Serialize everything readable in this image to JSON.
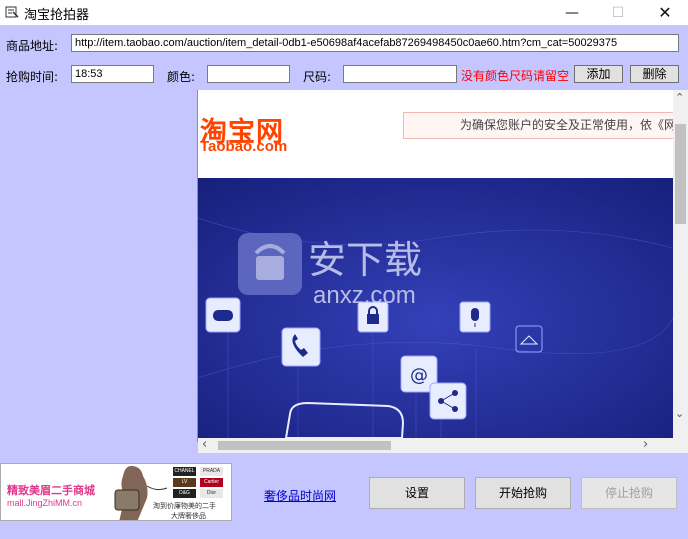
{
  "window": {
    "title": "淘宝抢拍器",
    "minimize_label": "—",
    "maximize_label": "☐",
    "close_label": "✕"
  },
  "form": {
    "url_label": "商品地址:",
    "url_value": "http://item.taobao.com/auction/item_detail-0db1-e50698af4acefab87269498450c0ae60.htm?cm_cat=50029375",
    "time_label": "抢购时间:",
    "time_value": "18:53",
    "color_label": "颜色:",
    "color_value": "",
    "size_label": "尺码:",
    "size_value": "",
    "warning": "没有颜色尺码请留空",
    "add_label": "添加",
    "delete_label": "删除"
  },
  "browser": {
    "logo_cn": "淘宝网",
    "logo_en": "Taobao.com",
    "notice": "为确保您账户的安全及正常使用，依《网"
  },
  "ad": {
    "text_cn": "精致美眉二手商城",
    "text_en": "mall.JingZhiMM.cn",
    "brands": [
      "CHANEL",
      "PRADA",
      "LV",
      "Cartier",
      "D&G",
      "Dior"
    ],
    "footer1": "淘到价廉物美的二手",
    "footer2": "大牌奢侈品"
  },
  "bottom": {
    "link_label": "奢侈品时尚网",
    "settings_label": "设置",
    "start_label": "开始抢购",
    "stop_label": "停止抢购"
  },
  "colors": {
    "background": "#c5c5ff",
    "banner": "#1e2a8c",
    "taobao_orange": "#ff4400",
    "warning": "#ff0000"
  }
}
